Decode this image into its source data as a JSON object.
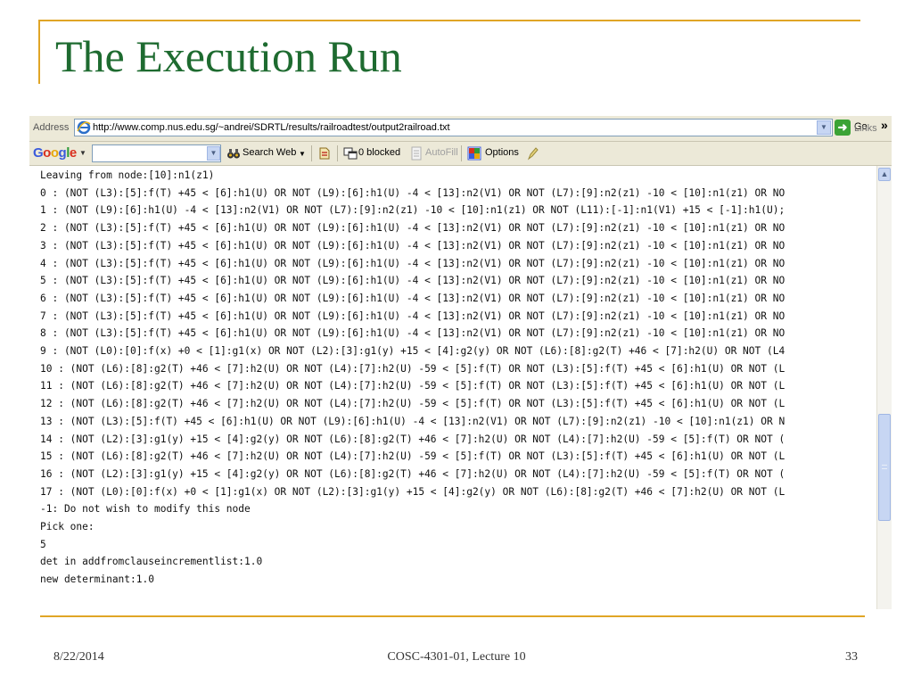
{
  "slide": {
    "title": "The Execution Run",
    "footer_date": "8/22/2014",
    "footer_center": "COSC-4301-01, Lecture 10",
    "page_number": "33"
  },
  "browser": {
    "address_label": "Address",
    "url": "http://www.comp.nus.edu.sg/~andrei/SDRTL/results/railroadtest/output2railroad.txt",
    "go_label": "Go",
    "links_label": "Links",
    "links_chevron": "»",
    "google_toolbar": {
      "logo_letters": [
        "G",
        "o",
        "o",
        "g",
        "l",
        "e"
      ],
      "logo_colors": [
        "#3b5bdb",
        "#d9301e",
        "#e8a70b",
        "#3b5bdb",
        "#2f9b3a",
        "#d9301e"
      ],
      "search_value": "",
      "search_web_label": "Search Web",
      "blocked_label": "0 blocked",
      "autofill_label": "AutoFill",
      "options_label": "Options"
    }
  },
  "document": {
    "lines": [
      "Leaving from node:[10]:n1(z1)",
      "0 : (NOT (L3):[5]:f(T) +45 < [6]:h1(U) OR NOT (L9):[6]:h1(U) -4 < [13]:n2(V1) OR NOT (L7):[9]:n2(z1) -10 < [10]:n1(z1) OR NO",
      "1 : (NOT (L9):[6]:h1(U) -4 < [13]:n2(V1) OR NOT (L7):[9]:n2(z1) -10 < [10]:n1(z1) OR NOT (L11):[-1]:n1(V1) +15 < [-1]:h1(U);",
      "2 : (NOT (L3):[5]:f(T) +45 < [6]:h1(U) OR NOT (L9):[6]:h1(U) -4 < [13]:n2(V1) OR NOT (L7):[9]:n2(z1) -10 < [10]:n1(z1) OR NO",
      "3 : (NOT (L3):[5]:f(T) +45 < [6]:h1(U) OR NOT (L9):[6]:h1(U) -4 < [13]:n2(V1) OR NOT (L7):[9]:n2(z1) -10 < [10]:n1(z1) OR NO",
      "4 : (NOT (L3):[5]:f(T) +45 < [6]:h1(U) OR NOT (L9):[6]:h1(U) -4 < [13]:n2(V1) OR NOT (L7):[9]:n2(z1) -10 < [10]:n1(z1) OR NO",
      "5 : (NOT (L3):[5]:f(T) +45 < [6]:h1(U) OR NOT (L9):[6]:h1(U) -4 < [13]:n2(V1) OR NOT (L7):[9]:n2(z1) -10 < [10]:n1(z1) OR NO",
      "6 : (NOT (L3):[5]:f(T) +45 < [6]:h1(U) OR NOT (L9):[6]:h1(U) -4 < [13]:n2(V1) OR NOT (L7):[9]:n2(z1) -10 < [10]:n1(z1) OR NO",
      "7 : (NOT (L3):[5]:f(T) +45 < [6]:h1(U) OR NOT (L9):[6]:h1(U) -4 < [13]:n2(V1) OR NOT (L7):[9]:n2(z1) -10 < [10]:n1(z1) OR NO",
      "8 : (NOT (L3):[5]:f(T) +45 < [6]:h1(U) OR NOT (L9):[6]:h1(U) -4 < [13]:n2(V1) OR NOT (L7):[9]:n2(z1) -10 < [10]:n1(z1) OR NO",
      "9 : (NOT (L0):[0]:f(x) +0 < [1]:g1(x) OR NOT (L2):[3]:g1(y) +15 < [4]:g2(y) OR NOT (L6):[8]:g2(T) +46 < [7]:h2(U) OR NOT (L4",
      "10 : (NOT (L6):[8]:g2(T) +46 < [7]:h2(U) OR NOT (L4):[7]:h2(U) -59 < [5]:f(T) OR NOT (L3):[5]:f(T) +45 < [6]:h1(U) OR NOT (L",
      "11 : (NOT (L6):[8]:g2(T) +46 < [7]:h2(U) OR NOT (L4):[7]:h2(U) -59 < [5]:f(T) OR NOT (L3):[5]:f(T) +45 < [6]:h1(U) OR NOT (L",
      "12 : (NOT (L6):[8]:g2(T) +46 < [7]:h2(U) OR NOT (L4):[7]:h2(U) -59 < [5]:f(T) OR NOT (L3):[5]:f(T) +45 < [6]:h1(U) OR NOT (L",
      "13 : (NOT (L3):[5]:f(T) +45 < [6]:h1(U) OR NOT (L9):[6]:h1(U) -4 < [13]:n2(V1) OR NOT (L7):[9]:n2(z1) -10 < [10]:n1(z1) OR N",
      "14 : (NOT (L2):[3]:g1(y) +15 < [4]:g2(y) OR NOT (L6):[8]:g2(T) +46 < [7]:h2(U) OR NOT (L4):[7]:h2(U) -59 < [5]:f(T) OR NOT (",
      "15 : (NOT (L6):[8]:g2(T) +46 < [7]:h2(U) OR NOT (L4):[7]:h2(U) -59 < [5]:f(T) OR NOT (L3):[5]:f(T) +45 < [6]:h1(U) OR NOT (L",
      "16 : (NOT (L2):[3]:g1(y) +15 < [4]:g2(y) OR NOT (L6):[8]:g2(T) +46 < [7]:h2(U) OR NOT (L4):[7]:h2(U) -59 < [5]:f(T) OR NOT (",
      "17 : (NOT (L0):[0]:f(x) +0 < [1]:g1(x) OR NOT (L2):[3]:g1(y) +15 < [4]:g2(y) OR NOT (L6):[8]:g2(T) +46 < [7]:h2(U) OR NOT (L",
      "-1: Do not wish to modify this node",
      "Pick one:",
      "5",
      "det in addfromclauseincrementlist:1.0",
      "new determinant:1.0"
    ]
  },
  "colors": {
    "title_green": "#1e6b30",
    "accent_gold": "#e0a526"
  }
}
